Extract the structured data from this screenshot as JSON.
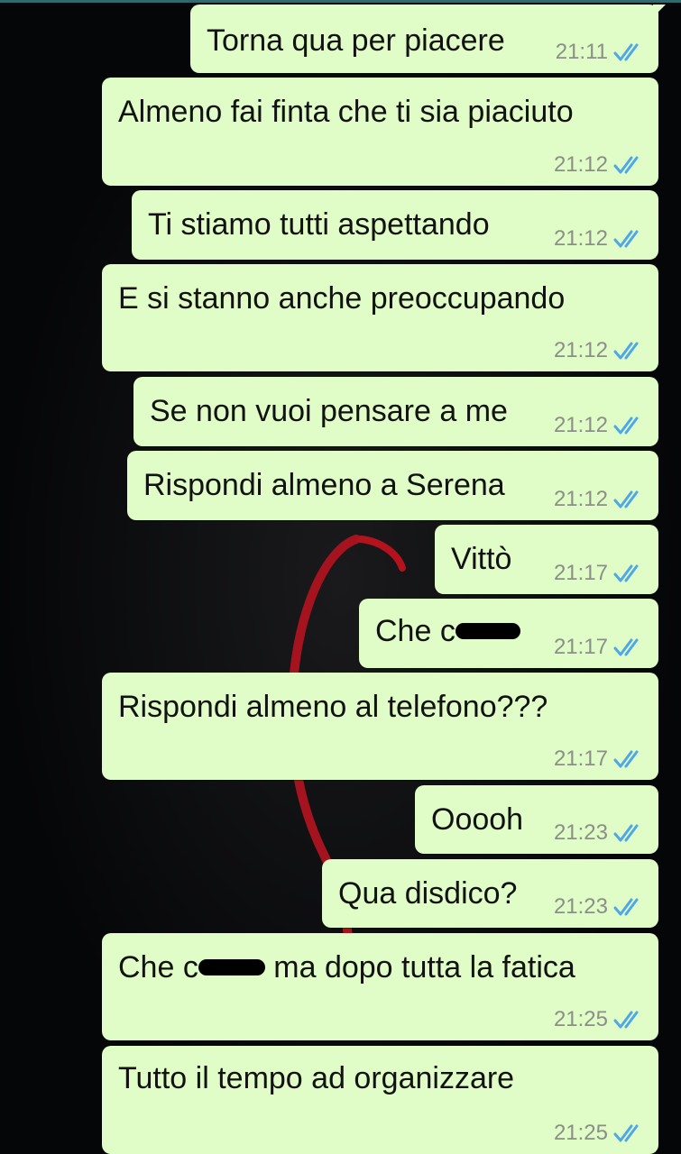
{
  "colors": {
    "bubble": "#e0fcc7",
    "text": "#121212",
    "time": "#8b8f88",
    "ticks": "#4fa7e8",
    "background": "#050607"
  },
  "ticks_icon": "double-check-icon",
  "messages": [
    {
      "text": "Torna qua per piacere",
      "time": "21:11"
    },
    {
      "text": "Almeno fai finta che ti sia piaciuto",
      "time": "21:12"
    },
    {
      "text": "Ti stiamo tutti aspettando",
      "time": "21:12"
    },
    {
      "text": "E si stanno anche preoccupando",
      "time": "21:12"
    },
    {
      "text": "Se non vuoi pensare a me",
      "time": "21:12"
    },
    {
      "text": "Rispondi almeno a Serena",
      "time": "21:12"
    },
    {
      "text": "Vittò",
      "time": "21:17"
    },
    {
      "text": "Che c",
      "time": "21:17"
    },
    {
      "text": "Rispondi almeno al telefono???",
      "time": "21:17"
    },
    {
      "text": "Ooooh",
      "time": "21:23"
    },
    {
      "text": "Qua disdico?",
      "time": "21:23"
    },
    {
      "text_before": "Che c",
      "text_after": " ma dopo tutta la fatica",
      "time": "21:25"
    },
    {
      "text": "Tutto il tempo ad organizzare",
      "time": "21:25"
    }
  ]
}
